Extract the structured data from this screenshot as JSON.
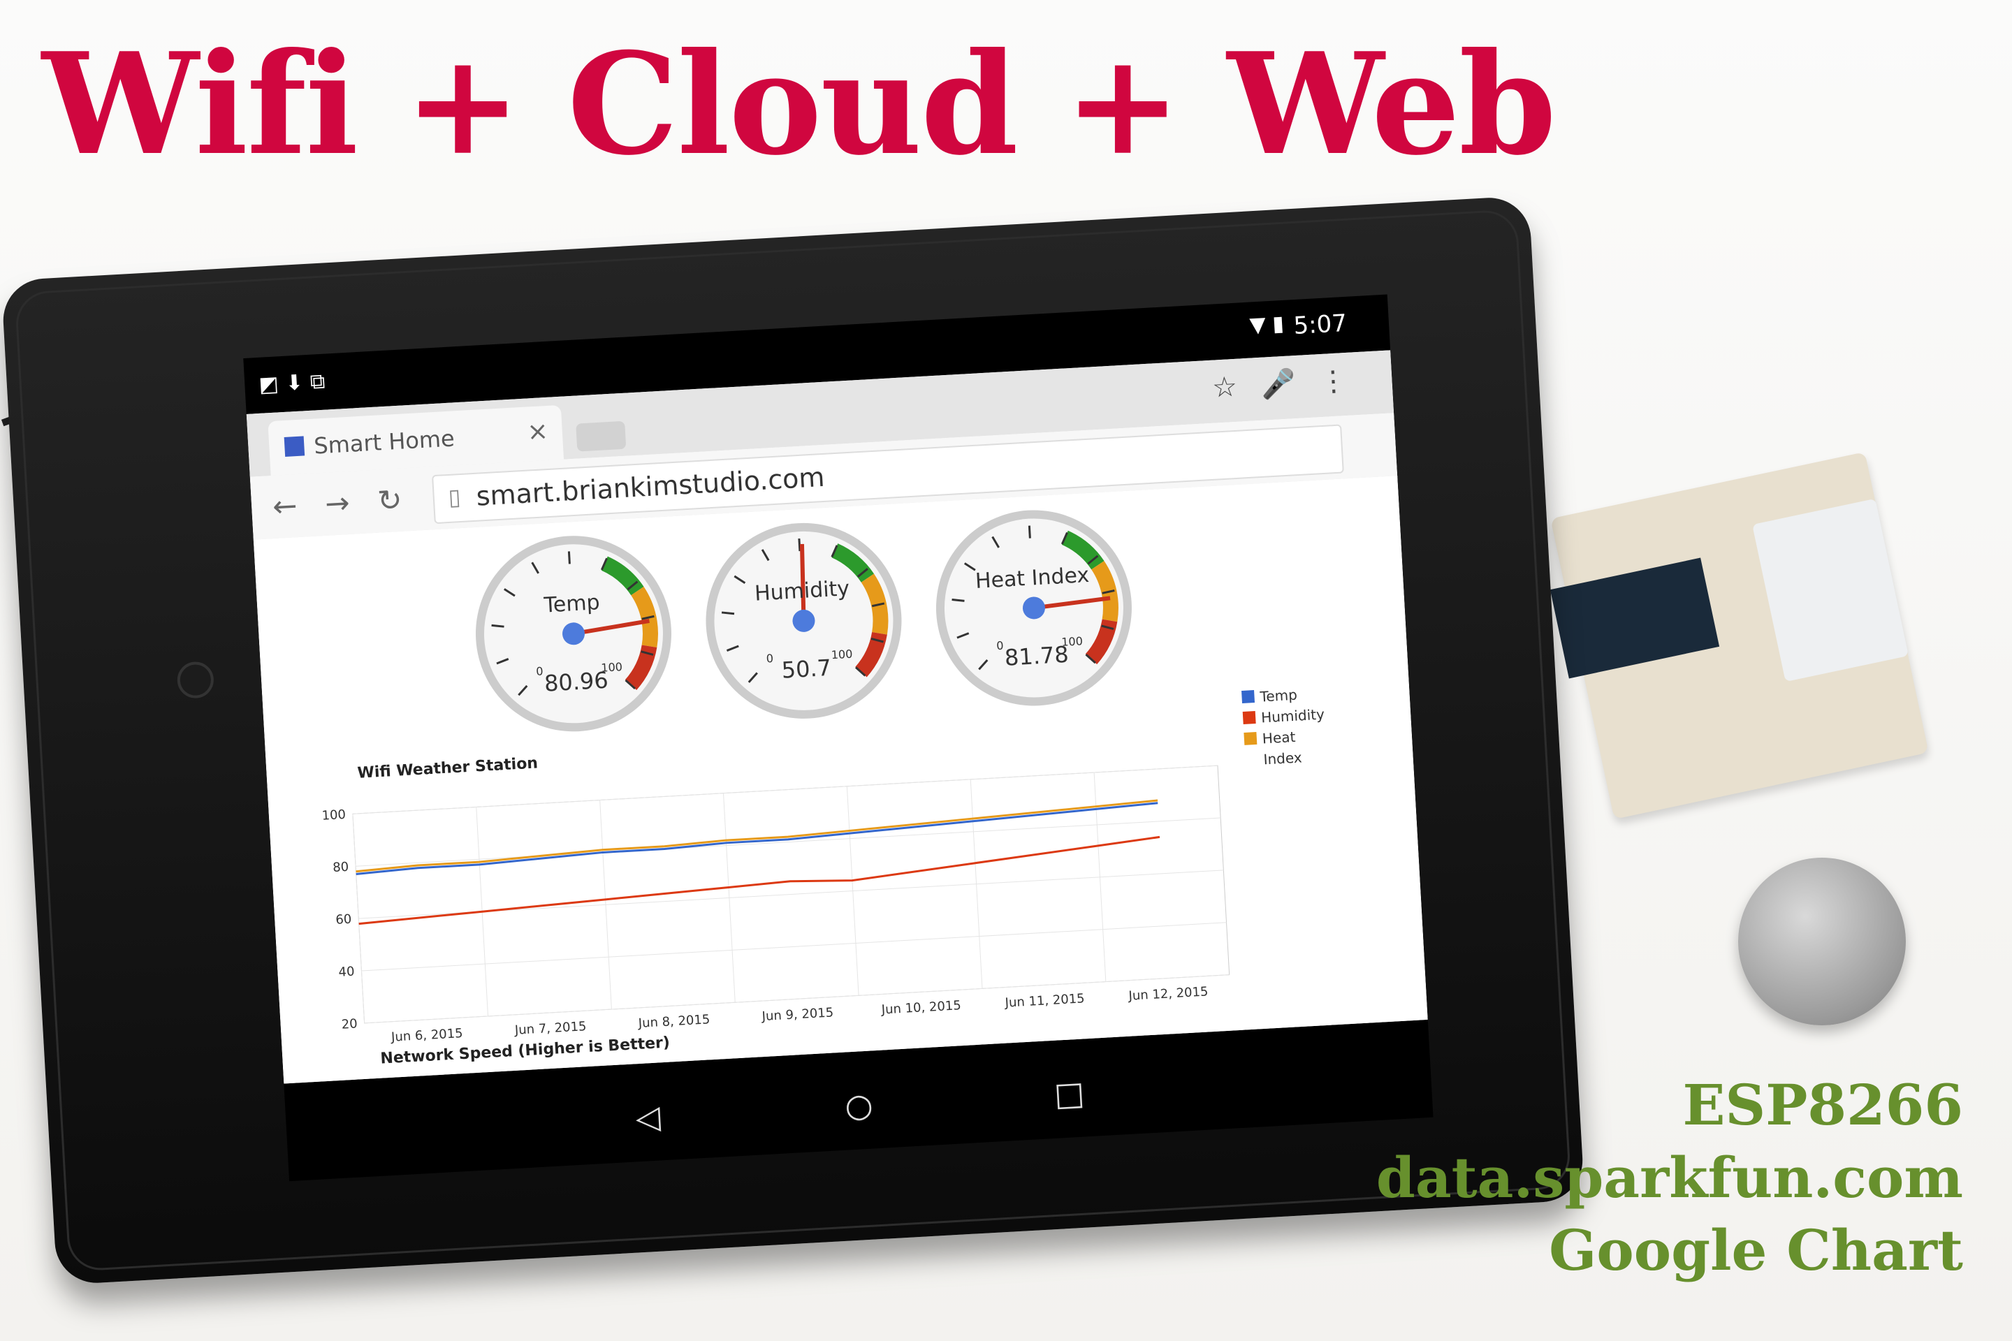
{
  "headline": "Wifi + Cloud + Web",
  "caption_lines": [
    "ESP8266",
    "data.sparkfun.com",
    "Google Chart"
  ],
  "colors": {
    "headline": "#d0063f",
    "caption": "#67902d"
  },
  "status": {
    "time": "5:07",
    "icons": "wifi-icon battery-icon"
  },
  "browser": {
    "tab_title": "Smart Home",
    "url": "smart.briankimstudio.com"
  },
  "gauges": [
    {
      "label": "Temp",
      "value": "80.96",
      "min": "0",
      "max": "100",
      "fraction": 0.8096
    },
    {
      "label": "Humidity",
      "value": "50.7",
      "min": "0",
      "max": "100",
      "fraction": 0.507
    },
    {
      "label": "Heat Index",
      "value": "81.78",
      "min": "0",
      "max": "100",
      "fraction": 0.8178
    }
  ],
  "chart_data": {
    "type": "line",
    "title": "Wifi Weather Station",
    "ylim": [
      20,
      100
    ],
    "yticks": [
      "100",
      "80",
      "60",
      "40",
      "20"
    ],
    "xticks": [
      "Jun 6, 2015",
      "Jun 7, 2015",
      "Jun 8, 2015",
      "Jun 9, 2015",
      "Jun 10, 2015",
      "Jun 11, 2015",
      "Jun 12, 2015"
    ],
    "x": [
      0,
      0.5,
      1,
      1.5,
      2,
      2.5,
      3,
      3.5,
      4,
      5,
      6,
      6.5
    ],
    "series": [
      {
        "name": "Temp",
        "color": "#3366cc",
        "values": [
          77,
          78,
          78,
          79,
          80,
          80,
          81,
          81,
          82,
          84,
          86,
          87
        ]
      },
      {
        "name": "Humidity",
        "color": "#dc3912",
        "values": [
          58,
          59,
          60,
          61,
          62,
          63,
          64,
          65,
          64,
          68,
          72,
          74
        ]
      },
      {
        "name": "Heat Index",
        "color": "#e69a1a",
        "values": [
          78,
          79,
          79,
          80,
          81,
          81,
          82,
          82,
          83,
          85,
          87,
          88
        ]
      }
    ]
  },
  "chart2_title": "Network Speed (Higher is Better)",
  "legend": [
    "Temp",
    "Humidity",
    "Heat Index"
  ]
}
